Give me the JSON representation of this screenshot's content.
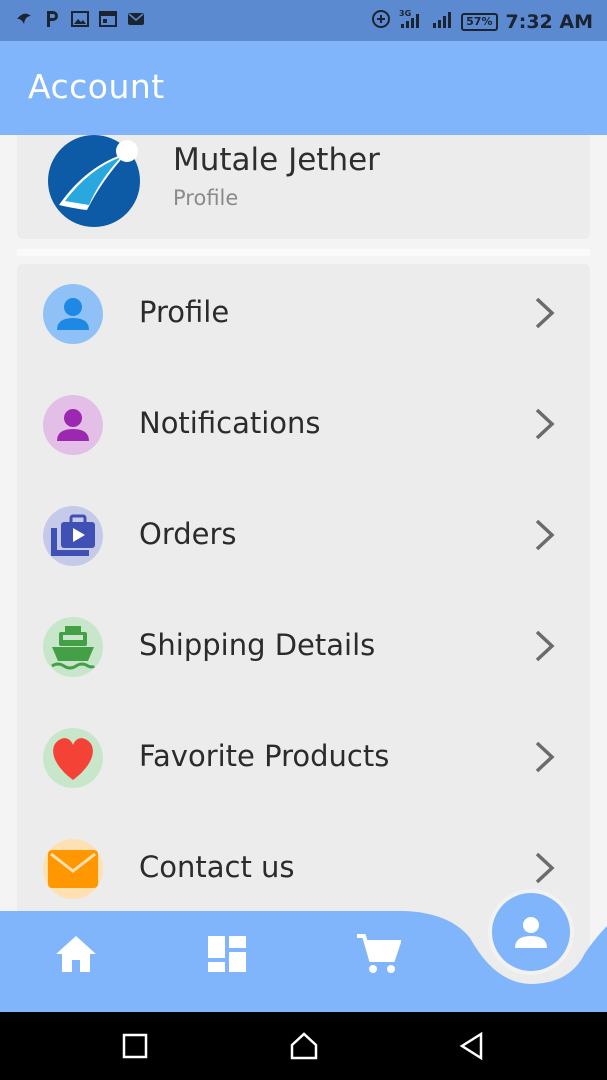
{
  "status_bar": {
    "time": "7:32 AM",
    "battery": "57%",
    "network": "3G"
  },
  "appbar": {
    "title": "Account"
  },
  "profile": {
    "name": "Mutale Jether",
    "subtitle": "Profile"
  },
  "menu": {
    "items": [
      {
        "label": "Profile",
        "icon": "person-icon",
        "icon_color": "#1e88e5",
        "bg": "#8fc1f7"
      },
      {
        "label": "Notifications",
        "icon": "person-icon",
        "icon_color": "#9c27b0",
        "bg": "#e3bfe8"
      },
      {
        "label": "Orders",
        "icon": "orders-icon",
        "icon_color": "#3f51b5",
        "bg": "#c5cae9"
      },
      {
        "label": "Shipping Details",
        "icon": "ship-icon",
        "icon_color": "#43a047",
        "bg": "#c8e6c9"
      },
      {
        "label": "Favorite Products",
        "icon": "heart-icon",
        "icon_color": "#f44336",
        "bg": "#c8e6c9"
      },
      {
        "label": "Contact us",
        "icon": "mail-icon",
        "icon_color": "#ff9800",
        "bg": "#ffe0b2"
      }
    ]
  },
  "colors": {
    "accent": "#80b5fb",
    "status_bar": "#5b8ad1"
  },
  "bottom_nav": {
    "items": [
      "home-icon",
      "dashboard-icon",
      "cart-icon",
      "account-icon"
    ]
  }
}
